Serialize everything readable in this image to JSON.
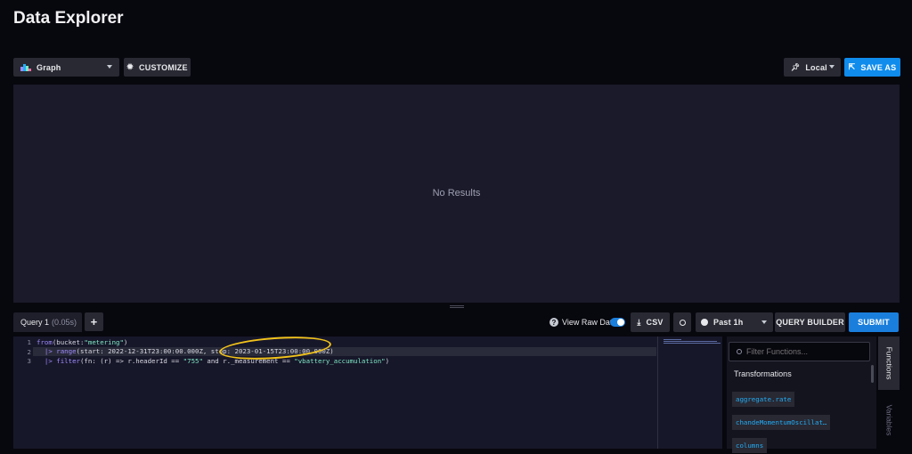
{
  "page": {
    "title": "Data Explorer"
  },
  "toolbar": {
    "viz_type": "Graph",
    "customize_label": "CUSTOMIZE",
    "timezone": "Local",
    "save_as_label": "SAVE AS"
  },
  "graph": {
    "empty_message": "No Results"
  },
  "query_bar": {
    "tab_label": "Query 1",
    "tab_time": "(0.05s)",
    "add_label": "+",
    "view_raw_label": "View Raw Data",
    "view_raw_on": true,
    "csv_label": "CSV",
    "time_range": "Past 1h",
    "query_builder_label": "QUERY BUILDER",
    "submit_label": "SUBMIT"
  },
  "editor": {
    "lines": [
      {
        "num": "1",
        "text": "from(bucket:\"metering\")"
      },
      {
        "num": "2",
        "text": "  |> range(start: 2022-12-31T23:00:00.000Z, stop: 2023-01-15T23:00:00.000Z)"
      },
      {
        "num": "3",
        "text": "  |> filter(fn: (r) => r.headerId == \"755\" and r._measurement == \"vbattery_accumulation\")"
      }
    ]
  },
  "functions": {
    "search_placeholder": "Filter Functions...",
    "section_title": "Transformations",
    "items": [
      "aggregate.rate",
      "chandeMomentumOscillat…",
      "columns"
    ]
  },
  "side_tabs": {
    "functions": "Functions",
    "variables": "Variables"
  },
  "colors": {
    "accent": "#0f8cec",
    "background": "#07070e",
    "annotation": "#f2c31a"
  }
}
